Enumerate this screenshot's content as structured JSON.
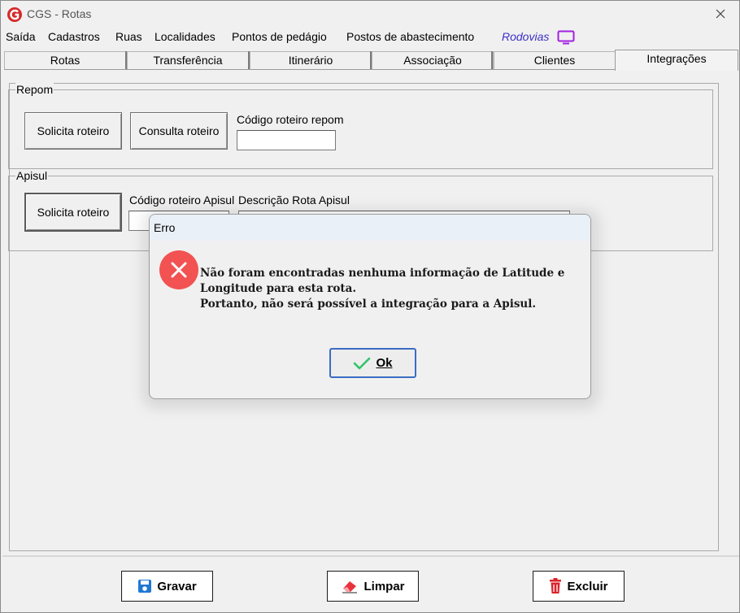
{
  "window": {
    "title": "CGS - Rotas"
  },
  "menu": {
    "items": [
      "Saída",
      "Cadastros",
      "Ruas",
      "Localidades",
      "Pontos de pedágio",
      "Postos de abastecimento"
    ],
    "rodovias_label": "Rodovias",
    "rodovias_color": "#3b30c8"
  },
  "tabs": [
    "Rotas",
    "Transferência",
    "Itinerário",
    "Associação",
    "Clientes",
    "Integrações"
  ],
  "active_tab": "Integrações",
  "repom": {
    "group_title": "Repom",
    "solicita_label": "Solicita roteiro",
    "consulta_label": "Consulta roteiro",
    "codigo_label": "Código roteiro repom",
    "codigo_value": ""
  },
  "apisul": {
    "group_title": "Apisul",
    "solicita_label": "Solicita roteiro",
    "codigo_label": "Código roteiro Apisul",
    "codigo_value": "",
    "descricao_label": "Descrição Rota Apisul",
    "descricao_value": ""
  },
  "actions": {
    "gravar_label": "Gravar",
    "limpar_label": "Limpar",
    "excluir_label": "Excluir"
  },
  "dialog": {
    "title": "Erro",
    "icon": "error-x-icon",
    "error_color": "#f25252",
    "message_lines": [
      "Não foram encontradas nenhuma informação de Latitude e",
      "Longitude para esta rota.",
      "Portanto, não será possível a integração para a Apisul."
    ],
    "ok_label": "Ok"
  }
}
